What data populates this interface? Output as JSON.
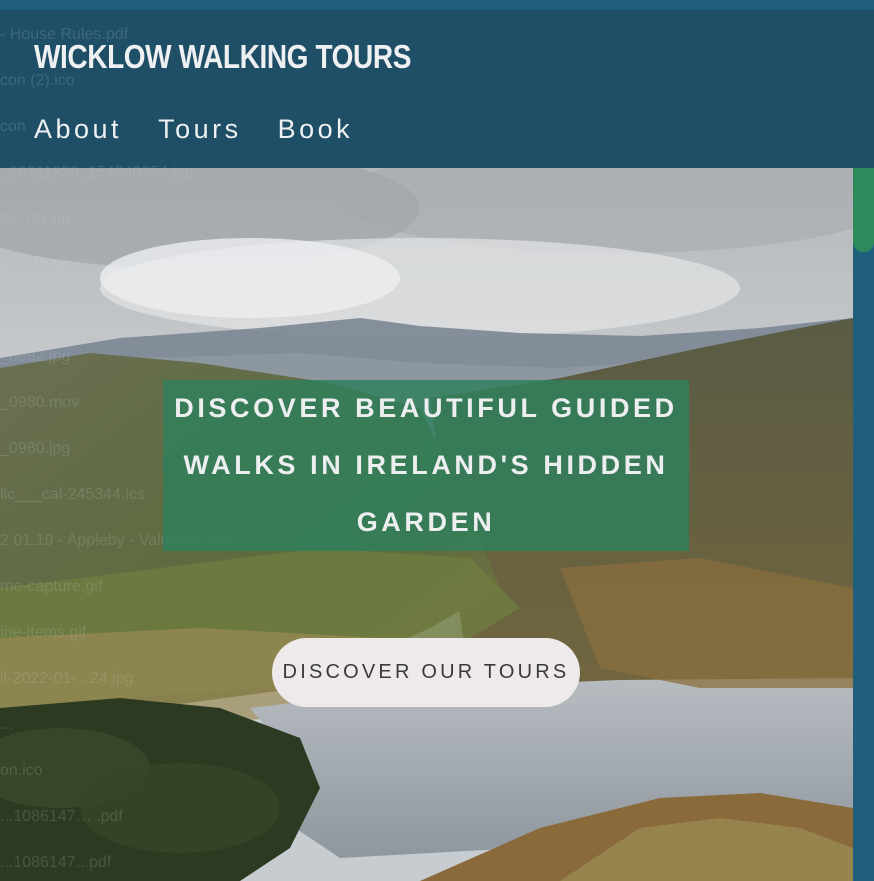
{
  "header": {
    "brand": "WICKLOW WALKING TOURS",
    "nav": [
      {
        "label": "About"
      },
      {
        "label": "Tours"
      },
      {
        "label": "Book"
      }
    ]
  },
  "hero": {
    "headline": "DISCOVER BEAUTIFUL GUIDED WALKS IN IRELAND'S HIDDEN GARDEN",
    "cta_label": "DISCOVER OUR TOURS"
  },
  "background_files": [
    "- House Rules.pdf",
    "con (2).ico",
    "con",
    "_20211230_154340254.jpg",
    "tos (2).zip",
    "tos (1).zip",
    "_0985.MOV",
    "_0982.jpg",
    "_0980.mov",
    "_0980.jpg",
    "lic___cal-245344.ics",
    "2.01.19 - Appleby - Valuation.pdf",
    "me-capture.gif",
    "ine-items.gif",
    "il-2022-01-...24.jpg",
    "...",
    "on.ico",
    "...1086147… .pdf",
    "...1086147...pdf"
  ],
  "colors": {
    "header_bg": "#1f4f66",
    "headline_box": "#2e805c",
    "cta_bg": "#eee9ea",
    "scrollbar_thumb": "#2e8a5a"
  }
}
